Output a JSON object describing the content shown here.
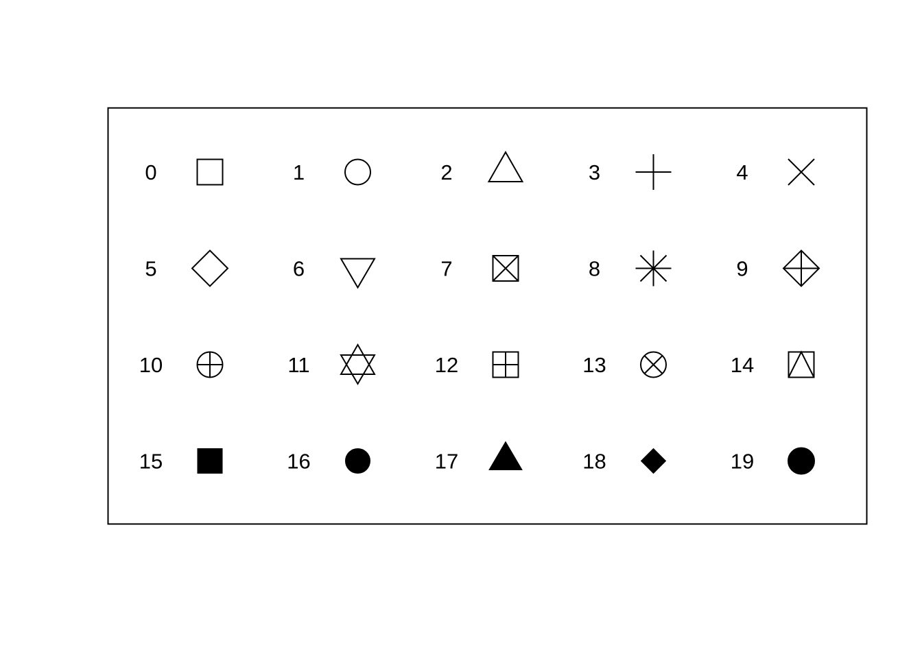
{
  "chart_data": {
    "type": "scatter",
    "title": "",
    "xlabel": "",
    "ylabel": "",
    "columns": 5,
    "rows": 4,
    "axes_visible": false,
    "box": true,
    "symbols": [
      {
        "pch": 0,
        "label": "0",
        "shape": "open-square"
      },
      {
        "pch": 1,
        "label": "1",
        "shape": "open-circle"
      },
      {
        "pch": 2,
        "label": "2",
        "shape": "open-triangle-up"
      },
      {
        "pch": 3,
        "label": "3",
        "shape": "plus"
      },
      {
        "pch": 4,
        "label": "4",
        "shape": "cross"
      },
      {
        "pch": 5,
        "label": "5",
        "shape": "open-diamond"
      },
      {
        "pch": 6,
        "label": "6",
        "shape": "open-triangle-down"
      },
      {
        "pch": 7,
        "label": "7",
        "shape": "square-cross"
      },
      {
        "pch": 8,
        "label": "8",
        "shape": "asterisk"
      },
      {
        "pch": 9,
        "label": "9",
        "shape": "diamond-plus"
      },
      {
        "pch": 10,
        "label": "10",
        "shape": "circle-plus"
      },
      {
        "pch": 11,
        "label": "11",
        "shape": "star-of-david"
      },
      {
        "pch": 12,
        "label": "12",
        "shape": "square-plus"
      },
      {
        "pch": 13,
        "label": "13",
        "shape": "circle-cross"
      },
      {
        "pch": 14,
        "label": "14",
        "shape": "square-triangle"
      },
      {
        "pch": 15,
        "label": "15",
        "shape": "filled-square"
      },
      {
        "pch": 16,
        "label": "16",
        "shape": "filled-circle-small"
      },
      {
        "pch": 17,
        "label": "17",
        "shape": "filled-triangle-up"
      },
      {
        "pch": 18,
        "label": "18",
        "shape": "filled-diamond"
      },
      {
        "pch": 19,
        "label": "19",
        "shape": "filled-circle"
      }
    ],
    "colors": {
      "stroke": "#000000",
      "fill": "#000000",
      "background": "#ffffff"
    }
  }
}
